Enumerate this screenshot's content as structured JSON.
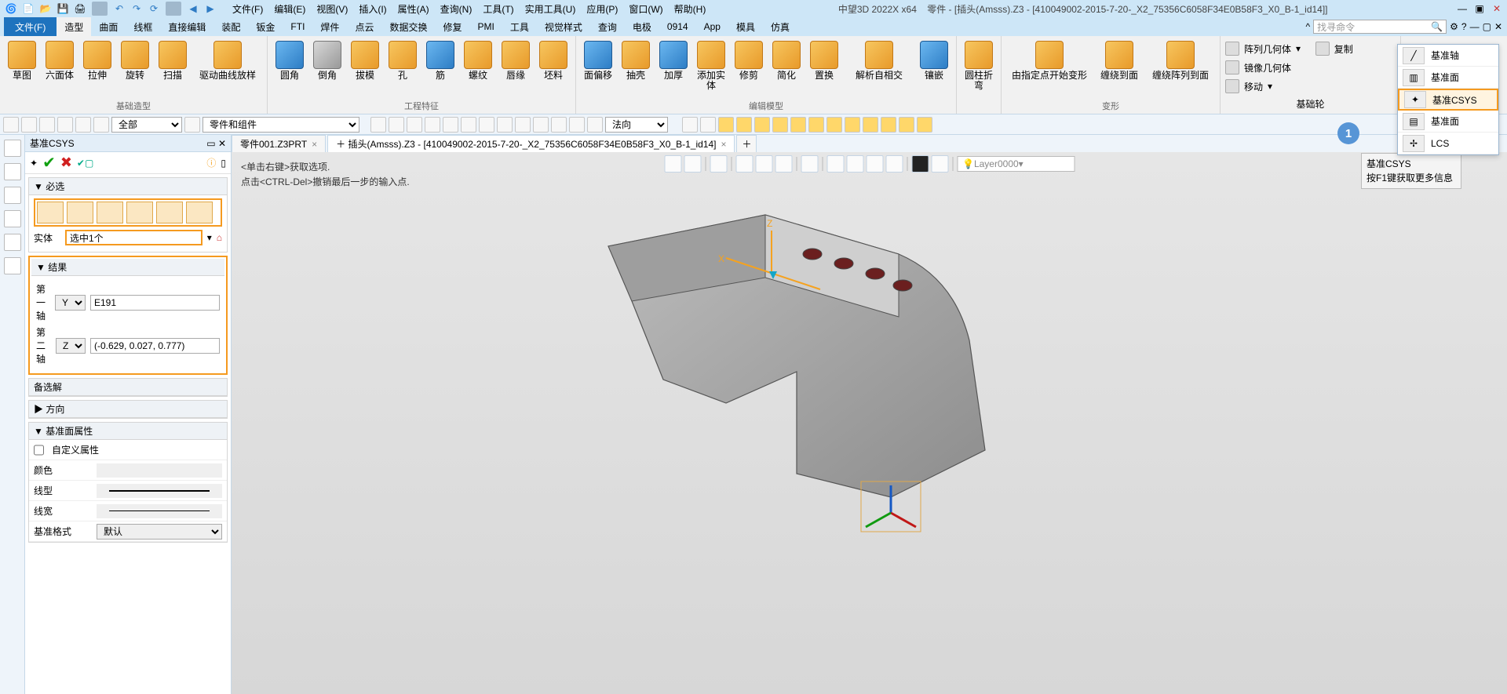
{
  "title": {
    "app": "中望3D 2022X x64",
    "doc": "零件 - [插头(Amsss).Z3 - [410049002-2015-7-20-_X2_75356C6058F34E0B58F3_X0_B-1_id14]]"
  },
  "menubar": [
    "文件(F)",
    "编辑(E)",
    "视图(V)",
    "插入(I)",
    "属性(A)",
    "查询(N)",
    "工具(T)",
    "实用工具(U)",
    "应用(P)",
    "窗口(W)",
    "帮助(H)"
  ],
  "ribbon_tabs": {
    "file": "文件(F)",
    "items": [
      "造型",
      "曲面",
      "线框",
      "直接编辑",
      "装配",
      "钣金",
      "FTI",
      "焊件",
      "点云",
      "数据交换",
      "修复",
      "PMI",
      "工具",
      "视觉样式",
      "查询",
      "电极",
      "0914",
      "App",
      "模具",
      "仿真"
    ],
    "active": "造型"
  },
  "search_placeholder": "找寻命令",
  "groups": {
    "g1": {
      "name": "基础造型",
      "items": [
        "草图",
        "六面体",
        "拉伸",
        "旋转",
        "扫描",
        "驱动曲线放样"
      ]
    },
    "g2": {
      "name": "工程特征",
      "items": [
        "圆角",
        "倒角",
        "拔模",
        "孔",
        "筋",
        "螺纹",
        "唇缘",
        "坯料"
      ]
    },
    "g3": {
      "name": "编辑模型",
      "items": [
        "面偏移",
        "抽壳",
        "加厚",
        "添加实体",
        "修剪",
        "简化",
        "置换",
        "解析自相交",
        "镶嵌"
      ]
    },
    "g4": {
      "name": "",
      "items": [
        "圆柱折弯"
      ]
    },
    "g5": {
      "name": "变形",
      "items": [
        "由指定点开始变形",
        "缠绕到面",
        "缠绕阵列到面"
      ]
    },
    "g6": {
      "name": "基础轮",
      "rows": [
        "阵列几何体",
        "镜像几何体",
        "移动"
      ]
    },
    "g7": {
      "name": "",
      "rows": [
        "复制"
      ]
    }
  },
  "datum_menu": {
    "title": "基准CSYS",
    "rows": [
      "基准轴",
      "基准面",
      "基准CSYS",
      "基准面",
      "LCS"
    ]
  },
  "badge": "1",
  "tooltip": {
    "l1": "基准CSYS",
    "l2": "按F1键获取更多信息"
  },
  "toolbar_combos": {
    "filter": "全部",
    "parts": "零件和组件",
    "dir": "法向"
  },
  "doctabs": [
    "零件001.Z3PRT",
    "＋  插头(Amsss).Z3 - [410049002-2015-7-20-_X2_75356C6058F34E0B58F3_X0_B-1_id14]"
  ],
  "panel": {
    "title": "基准CSYS",
    "sections": {
      "bixuan": "必选",
      "entity_label": "实体",
      "entity_value": "选中1个",
      "result": "结果",
      "axis1": "第一轴",
      "axis1_dir": "Y",
      "axis1_val": "E191",
      "axis2": "第二轴",
      "axis2_dir": "Z",
      "axis2_val": "(-0.629, 0.027, 0.777)",
      "beixuan": "备选解",
      "fangxiang": "方向",
      "datumprops": "基准面属性",
      "custom": "自定义属性",
      "color": "颜色",
      "linetype": "线型",
      "linewidth": "线宽",
      "format": "基准格式",
      "format_val": "默认"
    }
  },
  "canvas": {
    "msg1": "<单击右键>获取选项.",
    "msg2": "点击<CTRL-Del>撤销最后一步的输入点.",
    "layer": "Layer0000"
  }
}
